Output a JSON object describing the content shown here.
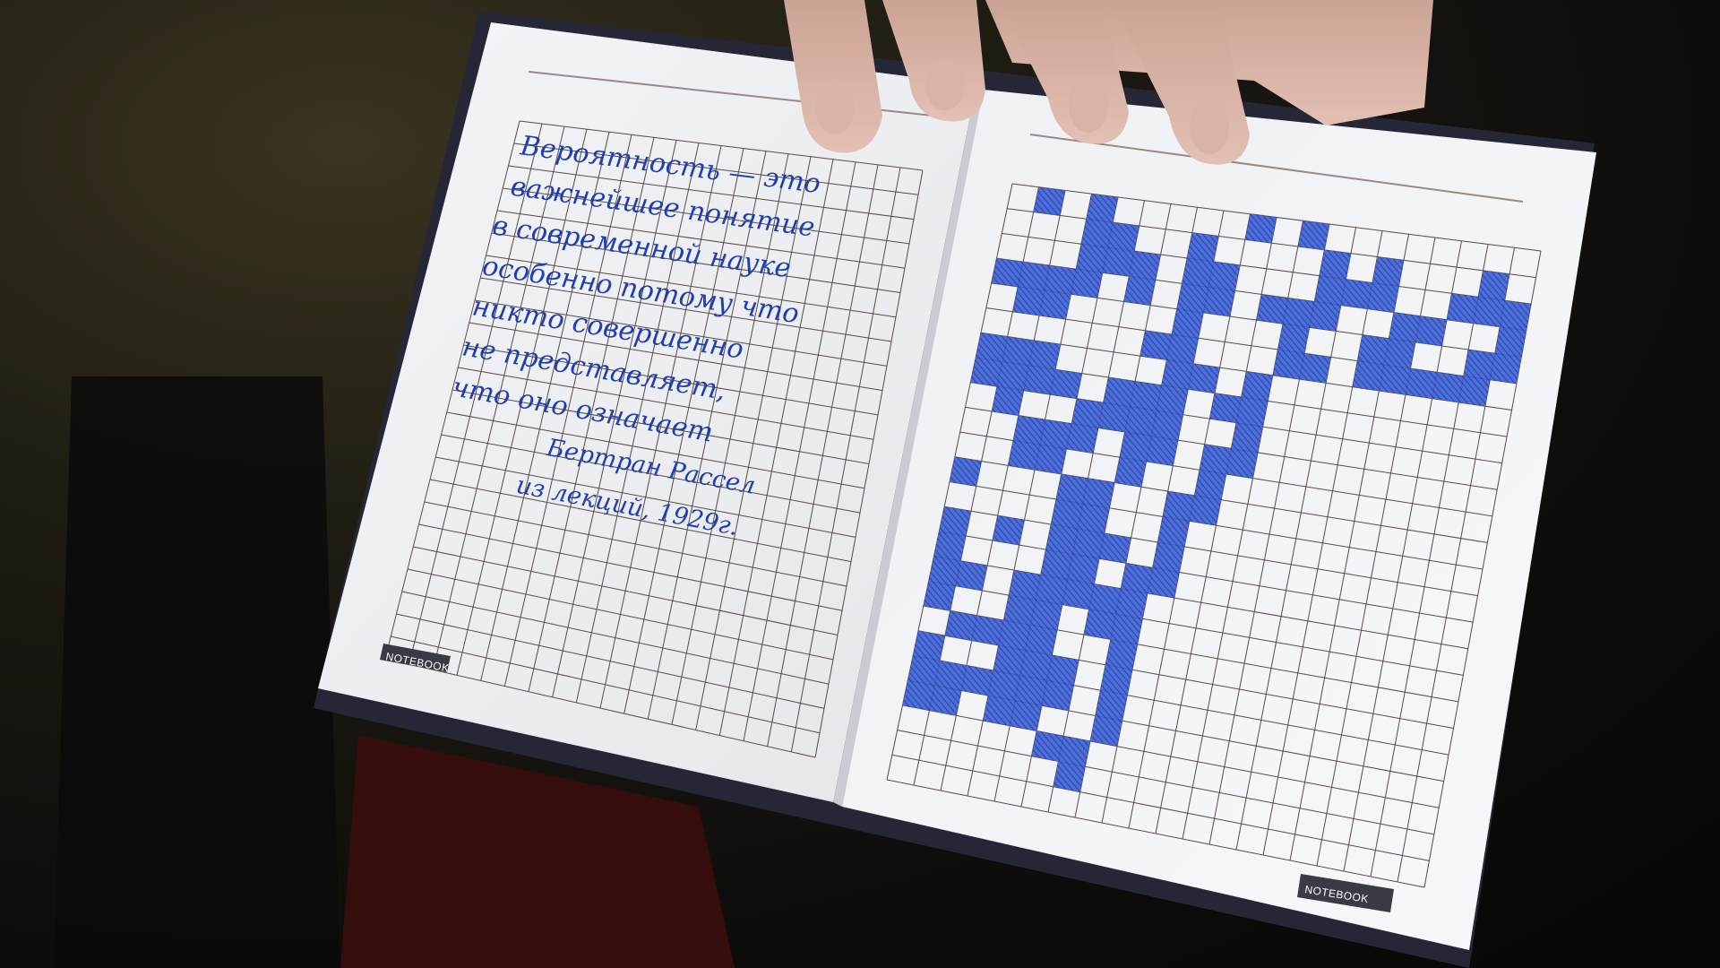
{
  "notebook": {
    "left_page": {
      "handwriting_lines": [
        "Вероятность — это",
        "важнейшее понятие",
        "в современной науке",
        "особенно потому что",
        "никто совершенно",
        "не представляет,",
        "что оно означает",
        "Бертран Рассел",
        "из лекций, 1929г."
      ],
      "brand_label": "NOTEBOOK"
    },
    "right_page": {
      "brand_label": "NOTEBOOK",
      "grid_cols": 20,
      "grid_rows": 24,
      "filled_cells": [
        [
          0,
          1
        ],
        [
          0,
          3
        ],
        [
          0,
          9
        ],
        [
          0,
          11
        ],
        [
          1,
          3
        ],
        [
          1,
          4
        ],
        [
          1,
          7
        ],
        [
          1,
          12
        ],
        [
          1,
          14
        ],
        [
          1,
          18
        ],
        [
          2,
          3
        ],
        [
          2,
          4
        ],
        [
          2,
          5
        ],
        [
          2,
          7
        ],
        [
          2,
          8
        ],
        [
          2,
          12
        ],
        [
          2,
          13
        ],
        [
          2,
          14
        ],
        [
          2,
          17
        ],
        [
          2,
          18
        ],
        [
          2,
          19
        ],
        [
          3,
          0
        ],
        [
          3,
          1
        ],
        [
          3,
          2
        ],
        [
          3,
          3
        ],
        [
          3,
          5
        ],
        [
          3,
          7
        ],
        [
          3,
          8
        ],
        [
          3,
          10
        ],
        [
          3,
          11
        ],
        [
          3,
          12
        ],
        [
          3,
          15
        ],
        [
          3,
          16
        ],
        [
          3,
          19
        ],
        [
          4,
          1
        ],
        [
          4,
          2
        ],
        [
          4,
          7
        ],
        [
          4,
          11
        ],
        [
          4,
          14
        ],
        [
          4,
          15
        ],
        [
          4,
          18
        ],
        [
          4,
          19
        ],
        [
          5,
          6
        ],
        [
          5,
          7
        ],
        [
          5,
          11
        ],
        [
          5,
          12
        ],
        [
          5,
          14
        ],
        [
          5,
          15
        ],
        [
          5,
          16
        ],
        [
          5,
          17
        ],
        [
          5,
          18
        ],
        [
          6,
          0
        ],
        [
          6,
          1
        ],
        [
          6,
          2
        ],
        [
          6,
          7
        ],
        [
          6,
          8
        ],
        [
          6,
          10
        ],
        [
          7,
          0
        ],
        [
          7,
          1
        ],
        [
          7,
          2
        ],
        [
          7,
          3
        ],
        [
          7,
          5
        ],
        [
          7,
          6
        ],
        [
          7,
          7
        ],
        [
          7,
          9
        ],
        [
          7,
          10
        ],
        [
          8,
          1
        ],
        [
          8,
          4
        ],
        [
          8,
          5
        ],
        [
          8,
          6
        ],
        [
          8,
          7
        ],
        [
          8,
          10
        ],
        [
          9,
          2
        ],
        [
          9,
          3
        ],
        [
          9,
          4
        ],
        [
          9,
          6
        ],
        [
          9,
          7
        ],
        [
          9,
          9
        ],
        [
          9,
          10
        ],
        [
          10,
          2
        ],
        [
          10,
          3
        ],
        [
          10,
          6
        ],
        [
          10,
          9
        ],
        [
          11,
          0
        ],
        [
          11,
          4
        ],
        [
          11,
          5
        ],
        [
          11,
          8
        ],
        [
          11,
          9
        ],
        [
          12,
          4
        ],
        [
          12,
          5
        ],
        [
          12,
          8
        ],
        [
          13,
          0
        ],
        [
          13,
          2
        ],
        [
          13,
          4
        ],
        [
          13,
          5
        ],
        [
          13,
          6
        ],
        [
          13,
          8
        ],
        [
          14,
          0
        ],
        [
          14,
          4
        ],
        [
          14,
          5
        ],
        [
          14,
          7
        ],
        [
          14,
          8
        ],
        [
          15,
          0
        ],
        [
          15,
          1
        ],
        [
          15,
          3
        ],
        [
          15,
          4
        ],
        [
          15,
          5
        ],
        [
          15,
          6
        ],
        [
          15,
          7
        ],
        [
          16,
          0
        ],
        [
          16,
          3
        ],
        [
          16,
          4
        ],
        [
          16,
          6
        ],
        [
          16,
          7
        ],
        [
          17,
          1
        ],
        [
          17,
          2
        ],
        [
          17,
          3
        ],
        [
          17,
          4
        ],
        [
          17,
          7
        ],
        [
          18,
          0
        ],
        [
          18,
          3
        ],
        [
          18,
          4
        ],
        [
          18,
          5
        ],
        [
          18,
          7
        ],
        [
          19,
          0
        ],
        [
          19,
          1
        ],
        [
          19,
          2
        ],
        [
          19,
          3
        ],
        [
          19,
          4
        ],
        [
          19,
          5
        ],
        [
          19,
          7
        ],
        [
          20,
          0
        ],
        [
          20,
          1
        ],
        [
          20,
          3
        ],
        [
          20,
          4
        ],
        [
          20,
          7
        ],
        [
          21,
          5
        ],
        [
          21,
          6
        ],
        [
          22,
          6
        ]
      ]
    }
  },
  "colors": {
    "ink": "#1f3fb0",
    "grid": "#5a4a44",
    "paper": "#f6f7f9",
    "cover": "#2b2c3a"
  }
}
